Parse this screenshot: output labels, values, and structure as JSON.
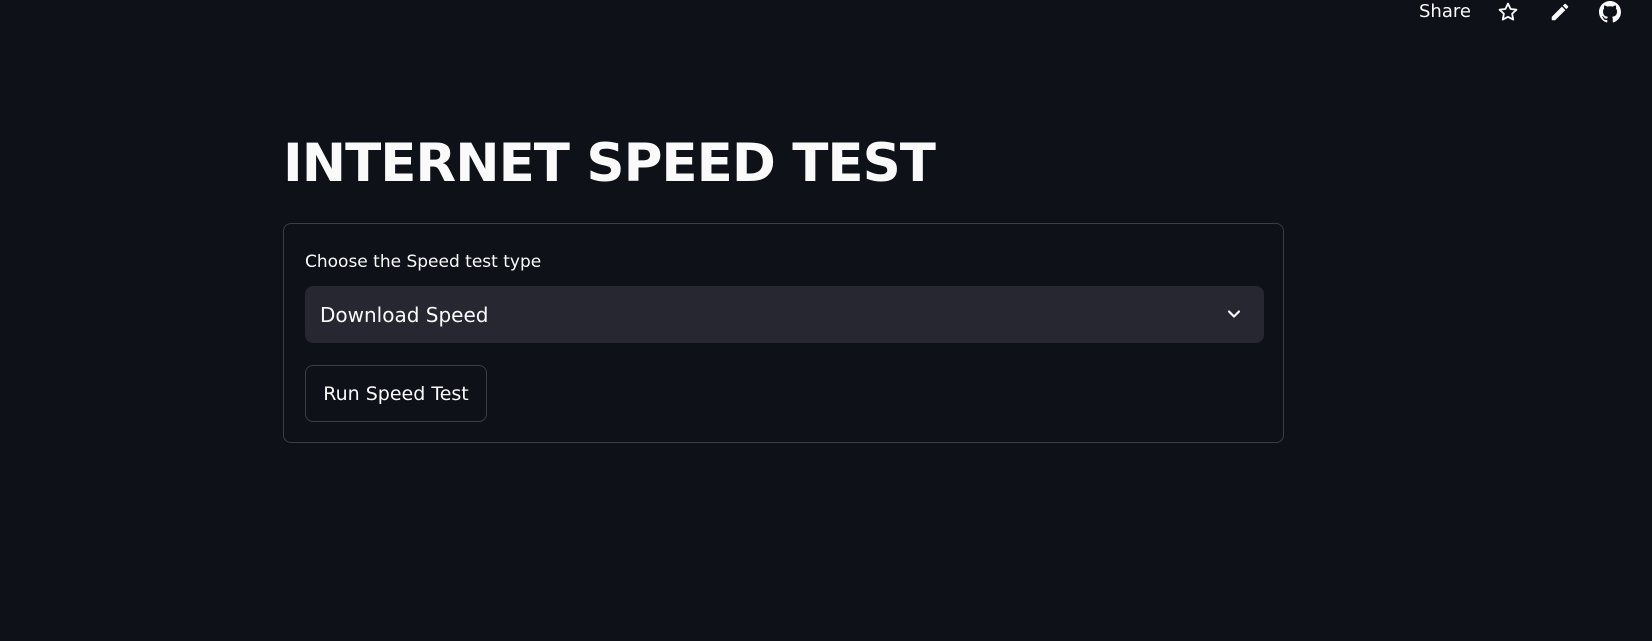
{
  "header": {
    "share_label": "Share",
    "icons": [
      "star-icon",
      "pencil-icon",
      "github-icon"
    ]
  },
  "main": {
    "title": "INTERNET SPEED TEST",
    "form": {
      "select_label": "Choose the Speed test type",
      "select_value": "Download Speed",
      "run_button_label": "Run Speed Test"
    }
  },
  "colors": {
    "background": "#0e1117",
    "text": "#fafafa",
    "select_background": "#262730",
    "border": "#3b3e47"
  }
}
